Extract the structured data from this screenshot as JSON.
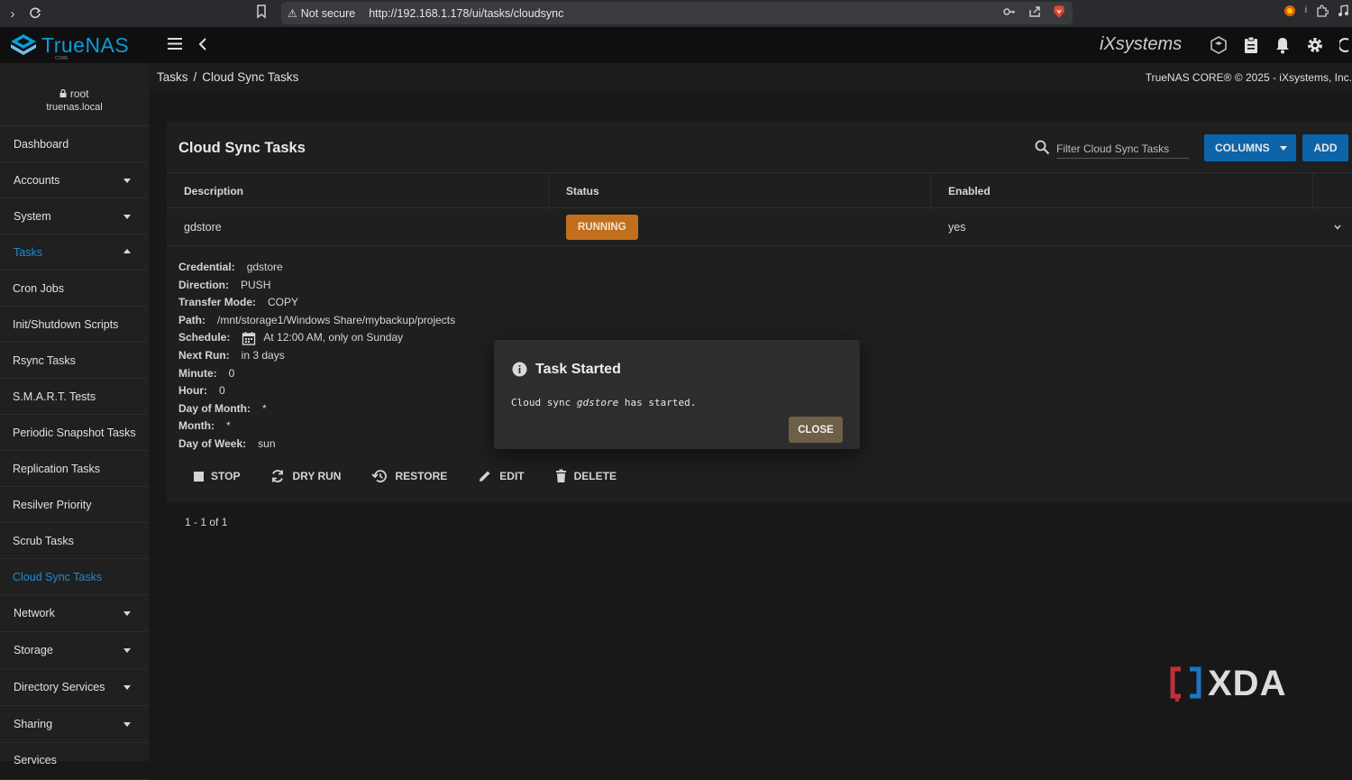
{
  "browser": {
    "security_label": "Not secure",
    "url": "http://192.168.1.178/ui/tasks/cloudsync"
  },
  "header": {
    "logo_text": "TrueNAS",
    "logo_sub": "CORE",
    "vendor_logo": "iXsystems"
  },
  "user": {
    "name": "root",
    "host": "truenas.local"
  },
  "sidebar": {
    "items": [
      {
        "label": "Dashboard"
      },
      {
        "label": "Accounts"
      },
      {
        "label": "System"
      },
      {
        "label": "Tasks"
      },
      {
        "label": "Cron Jobs"
      },
      {
        "label": "Init/Shutdown Scripts"
      },
      {
        "label": "Rsync Tasks"
      },
      {
        "label": "S.M.A.R.T. Tests"
      },
      {
        "label": "Periodic Snapshot Tasks"
      },
      {
        "label": "Replication Tasks"
      },
      {
        "label": "Resilver Priority"
      },
      {
        "label": "Scrub Tasks"
      },
      {
        "label": "Cloud Sync Tasks"
      },
      {
        "label": "Network"
      },
      {
        "label": "Storage"
      },
      {
        "label": "Directory Services"
      },
      {
        "label": "Sharing"
      },
      {
        "label": "Services"
      }
    ]
  },
  "breadcrumb": {
    "parent": "Tasks",
    "separator": "/",
    "current": "Cloud Sync Tasks"
  },
  "copyright": "TrueNAS CORE® © 2025 - iXsystems, Inc.",
  "card": {
    "title": "Cloud Sync Tasks",
    "filter_placeholder": "Filter Cloud Sync Tasks",
    "columns_label": "COLUMNS",
    "add_label": "ADD"
  },
  "table": {
    "columns": [
      "Description",
      "Status",
      "Enabled"
    ],
    "rows": [
      {
        "description": "gdstore",
        "status": "RUNNING",
        "enabled": "yes"
      }
    ]
  },
  "details": {
    "credential": {
      "label": "Credential:",
      "value": "gdstore"
    },
    "direction": {
      "label": "Direction:",
      "value": "PUSH"
    },
    "transfer_mode": {
      "label": "Transfer Mode:",
      "value": "COPY"
    },
    "path": {
      "label": "Path:",
      "value": "/mnt/storage1/Windows Share/mybackup/projects"
    },
    "schedule": {
      "label": "Schedule:",
      "value": "At 12:00 AM, only on Sunday"
    },
    "next_run": {
      "label": "Next Run:",
      "value": "in 3 days"
    },
    "minute": {
      "label": "Minute:",
      "value": "0"
    },
    "hour": {
      "label": "Hour:",
      "value": "0"
    },
    "day_of_month": {
      "label": "Day of Month:",
      "value": "*"
    },
    "month": {
      "label": "Month:",
      "value": "*"
    },
    "day_of_week": {
      "label": "Day of Week:",
      "value": "sun"
    }
  },
  "actions": {
    "stop": "STOP",
    "dry_run": "DRY RUN",
    "restore": "RESTORE",
    "edit": "EDIT",
    "delete": "DELETE"
  },
  "pager": "1 - 1 of 1",
  "dialog": {
    "title": "Task Started",
    "message_prefix": "Cloud sync ",
    "message_task": "gdstore",
    "message_suffix": " has started.",
    "close_label": "CLOSE"
  },
  "watermark": "XDA",
  "colors": {
    "accent": "#0d64a8",
    "running": "#c26f1d",
    "active_nav": "#1e8bd1"
  }
}
